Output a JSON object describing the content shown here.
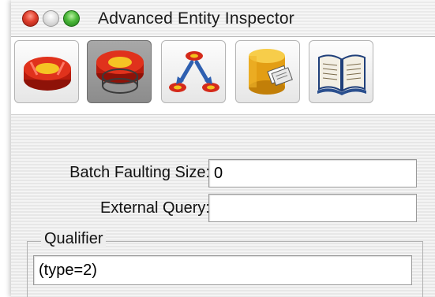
{
  "window": {
    "title": "Advanced Entity Inspector"
  },
  "toolbar": {
    "tools": [
      {
        "icon": "entity-icon",
        "selected": false
      },
      {
        "icon": "advanced-entity-icon",
        "selected": true
      },
      {
        "icon": "relationship-icon",
        "selected": false
      },
      {
        "icon": "stored-procedure-icon",
        "selected": false
      },
      {
        "icon": "documentation-icon",
        "selected": false
      }
    ]
  },
  "form": {
    "batch_faulting_label": "Batch Faulting Size:",
    "batch_faulting_value": "0",
    "external_query_label": "External Query:",
    "external_query_value": "",
    "qualifier_label": "Qualifier",
    "qualifier_value": "(type=2)"
  },
  "colors": {
    "accent_red": "#d42a1a",
    "accent_yellow": "#f2c21e",
    "accent_blue": "#2e5fb0"
  }
}
